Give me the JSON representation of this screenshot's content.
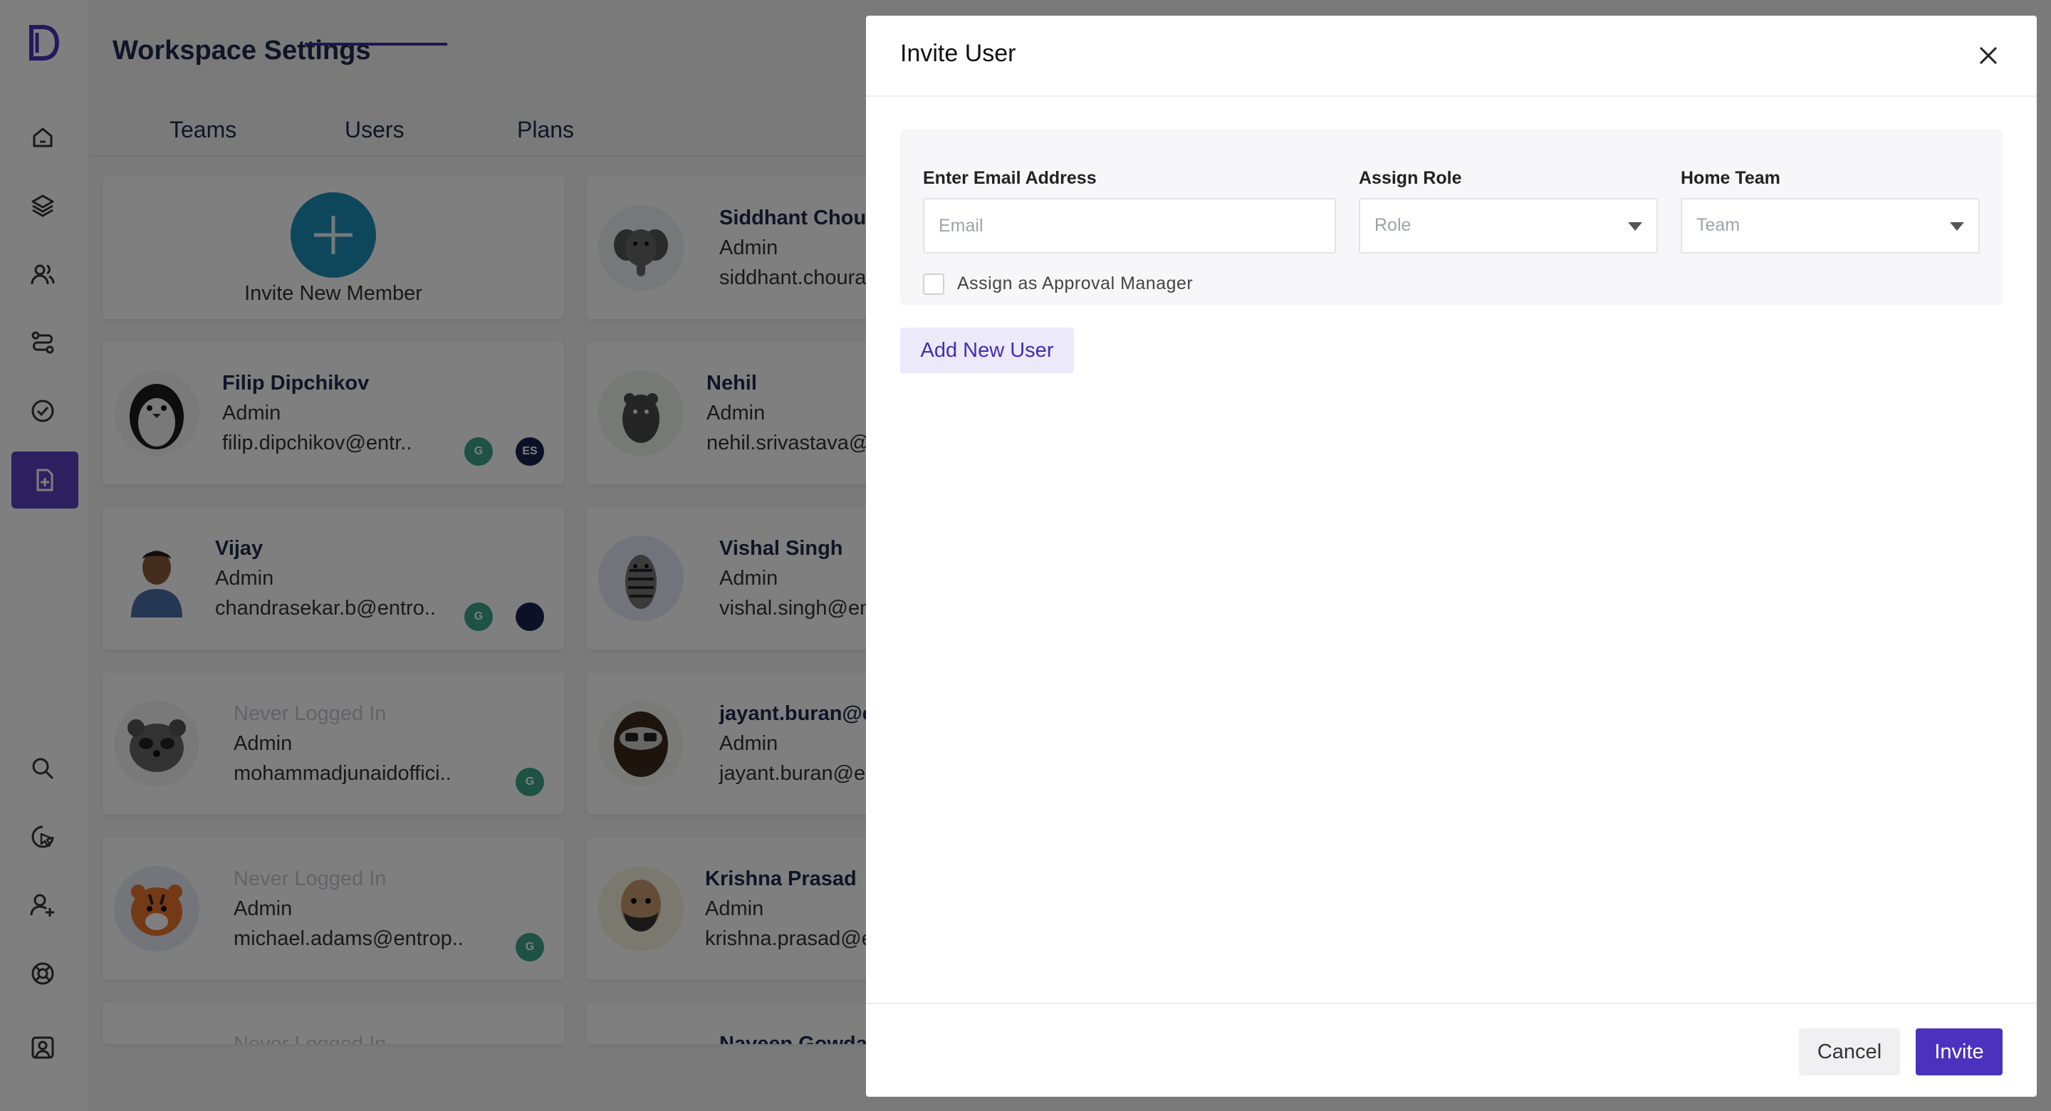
{
  "app": {
    "logo_letter": "D",
    "page_title": "Workspace Settings",
    "tabs": [
      {
        "label": "Teams"
      },
      {
        "label": "Users"
      },
      {
        "label": "Plans"
      }
    ],
    "active_tab": "Users",
    "sidebar_icons": [
      "home-icon",
      "layers-icon",
      "users-icon",
      "workflow-icon",
      "check-badge-icon",
      "workspace-settings-icon",
      "search-icon",
      "pointer-click-icon",
      "add-user-icon",
      "help-lifebuoy-icon",
      "profile-icon"
    ]
  },
  "cards": {
    "invite_label": "Invite New Member",
    "items": [
      {
        "name": "Siddhant Chour",
        "role": "Admin",
        "email": "siddhant.choura"
      },
      {
        "name": "Filip Dipchikov",
        "role": "Admin",
        "email": "filip.dipchikov@entr..",
        "badges": [
          "G",
          "ES"
        ]
      },
      {
        "name": "Nehil",
        "role": "Admin",
        "email": "nehil.srivastava@"
      },
      {
        "name": "Vijay",
        "role": "Admin",
        "email": "chandrasekar.b@entro..",
        "badges": [
          "G",
          ""
        ]
      },
      {
        "name": "Vishal Singh",
        "role": "Admin",
        "email": "vishal.singh@en"
      },
      {
        "name": "Never Logged In",
        "role": "Admin",
        "email": "mohammadjunaidoffici..",
        "badges": [
          "G"
        ]
      },
      {
        "name": "jayant.buran@e",
        "role": "Admin",
        "email": "jayant.buran@e"
      },
      {
        "name": "Never Logged In",
        "role": "Admin",
        "email": "michael.adams@entrop..",
        "badges": [
          "G"
        ]
      },
      {
        "name": "Krishna Prasad",
        "role": "Admin",
        "email": "krishna.prasad@e"
      },
      {
        "name": "Never Logged In",
        "role": "",
        "email": ""
      },
      {
        "name": "Naveen Gowda",
        "role": "",
        "email": ""
      }
    ]
  },
  "modal": {
    "title": "Invite User",
    "email_label": "Enter Email Address",
    "email_placeholder": "Email",
    "role_label": "Assign Role",
    "role_placeholder": "Role",
    "team_label": "Home Team",
    "team_placeholder": "Team",
    "approval_checkbox_label": "Assign as Approval Manager",
    "approval_checked": false,
    "add_user_button": "Add New User",
    "cancel_button": "Cancel",
    "invite_button": "Invite"
  },
  "colors": {
    "accent": "#4a32bf",
    "sidebar_active": "#5a3fc0",
    "badge_green": "#3aa58a",
    "badge_navy": "#1b2350",
    "overlay": "rgba(0,0,0,0.5)"
  }
}
